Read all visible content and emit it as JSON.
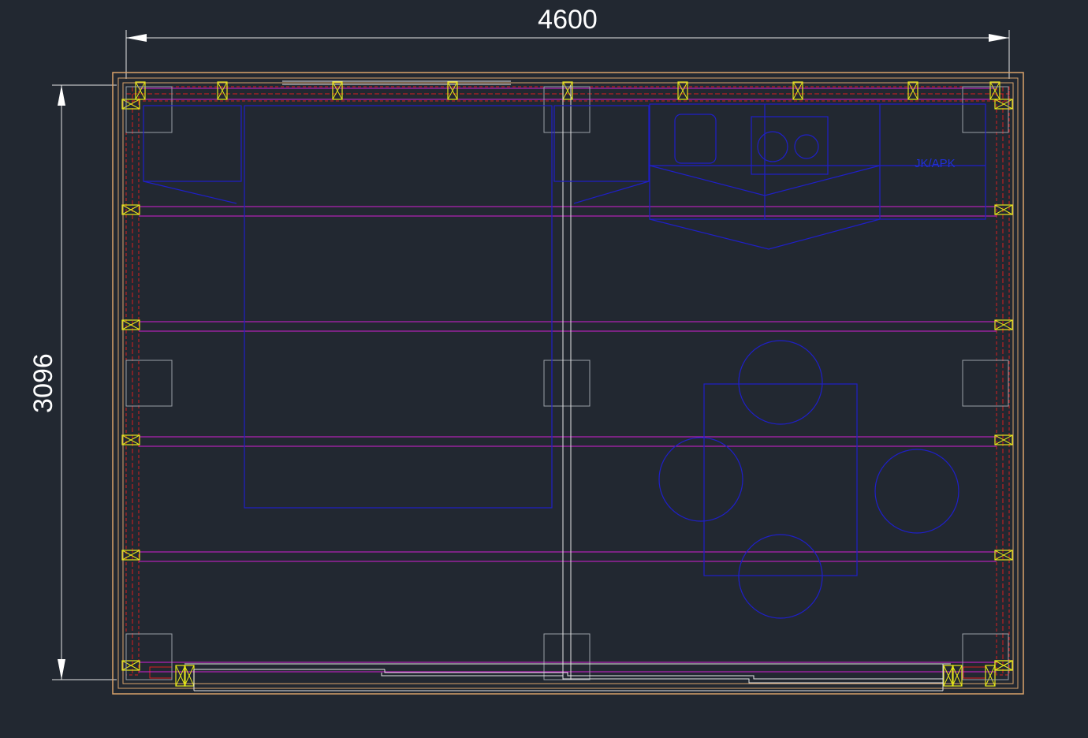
{
  "drawing": {
    "dimension_width": "4600",
    "dimension_height": "3096",
    "room_label": "JK/APK"
  },
  "colors": {
    "background": "#222831",
    "wall_outline": "#d9a36a",
    "wall_fill_red": "#d81e1e",
    "stud_yellow": "#e6e61a",
    "joist_magenta": "#d21fd2",
    "furniture_blue": "#1f1fc8",
    "line_white": "#e6e6e6",
    "grey": "#9aa0a6"
  }
}
